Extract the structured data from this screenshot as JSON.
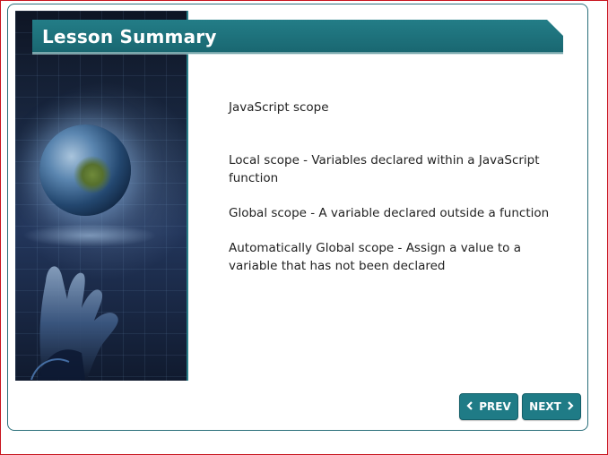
{
  "header": {
    "title": "Lesson Summary"
  },
  "summary": {
    "topic": "JavaScript scope",
    "points": [
      "Local scope - Variables declared within a JavaScript function",
      "Global scope - A variable declared outside a function",
      "Automatically Global scope - Assign a value to a variable that has not been declared"
    ]
  },
  "nav": {
    "prev_label": "PREV",
    "next_label": "NEXT",
    "prev_icon": "chevron-left-icon",
    "next_icon": "chevron-right-icon"
  },
  "colors": {
    "header_bg": "#1f6f78",
    "button_bg": "#1f7b86",
    "frame_border": "#c8141e",
    "card_border": "#2a6f7a"
  }
}
